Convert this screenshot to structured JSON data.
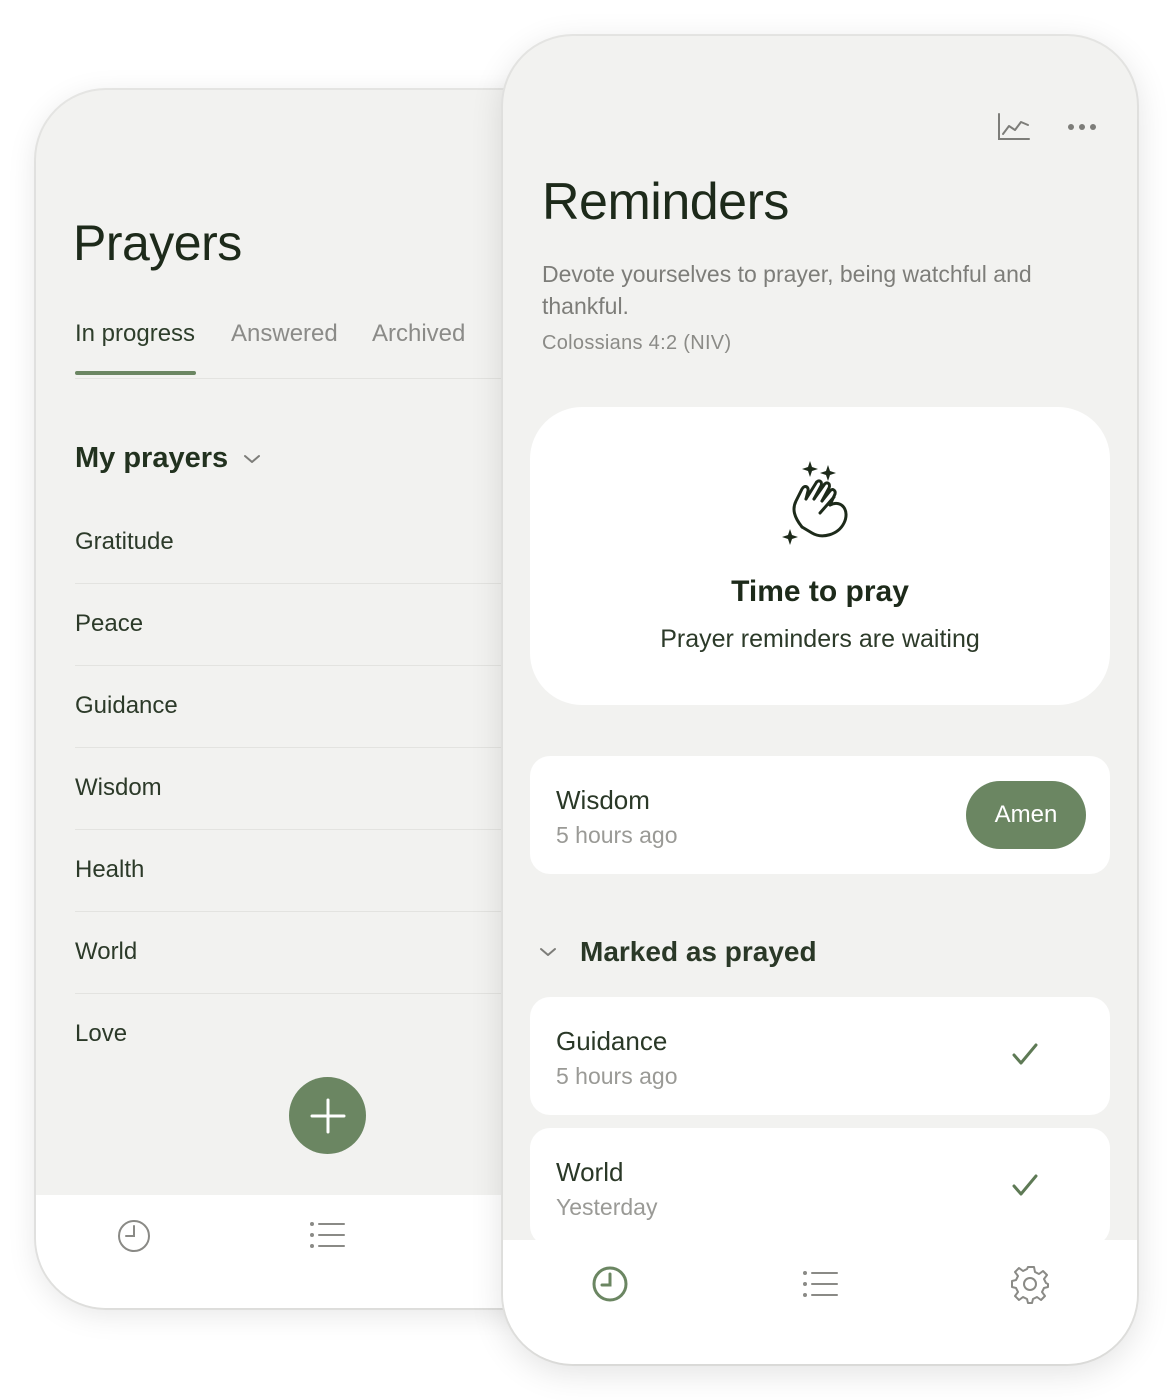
{
  "prayers_screen": {
    "title": "Prayers",
    "tabs": [
      {
        "label": "In progress",
        "active": true
      },
      {
        "label": "Answered",
        "active": false
      },
      {
        "label": "Archived",
        "active": false
      }
    ],
    "group": {
      "label": "My prayers",
      "icon": "chevron-down-icon"
    },
    "items": [
      "Gratitude",
      "Peace",
      "Guidance",
      "Wisdom",
      "Health",
      "World",
      "Love"
    ],
    "fab_icon": "plus-icon",
    "nav": [
      {
        "icon": "clock-icon",
        "active": false
      },
      {
        "icon": "list-icon",
        "active": false
      }
    ]
  },
  "reminders_screen": {
    "title": "Reminders",
    "actions": [
      {
        "icon": "chart-icon"
      },
      {
        "icon": "more-icon"
      }
    ],
    "verse": "Devote yourselves to prayer, being watchful and thankful.",
    "verse_ref": "Colossians 4:2 (NIV)",
    "hero": {
      "icon": "praying-hands-icon",
      "title": "Time to pray",
      "subtitle": "Prayer reminders are waiting"
    },
    "pending": {
      "name": "Wisdom",
      "time": "5 hours ago",
      "button": "Amen"
    },
    "marked_section": {
      "label": "Marked as prayed",
      "icon": "chevron-down-icon"
    },
    "marked": [
      {
        "name": "Guidance",
        "time": "5 hours ago",
        "icon": "check-icon"
      },
      {
        "name": "World",
        "time": "Yesterday",
        "icon": "check-icon"
      }
    ],
    "nav": [
      {
        "icon": "clock-icon",
        "active": true
      },
      {
        "icon": "list-icon",
        "active": false
      },
      {
        "icon": "gear-icon",
        "active": false
      }
    ]
  },
  "colors": {
    "accent": "#6b8662",
    "background": "#f2f2f0",
    "card": "#ffffff",
    "text": "#1d2a1a",
    "muted": "#9a9a96"
  }
}
